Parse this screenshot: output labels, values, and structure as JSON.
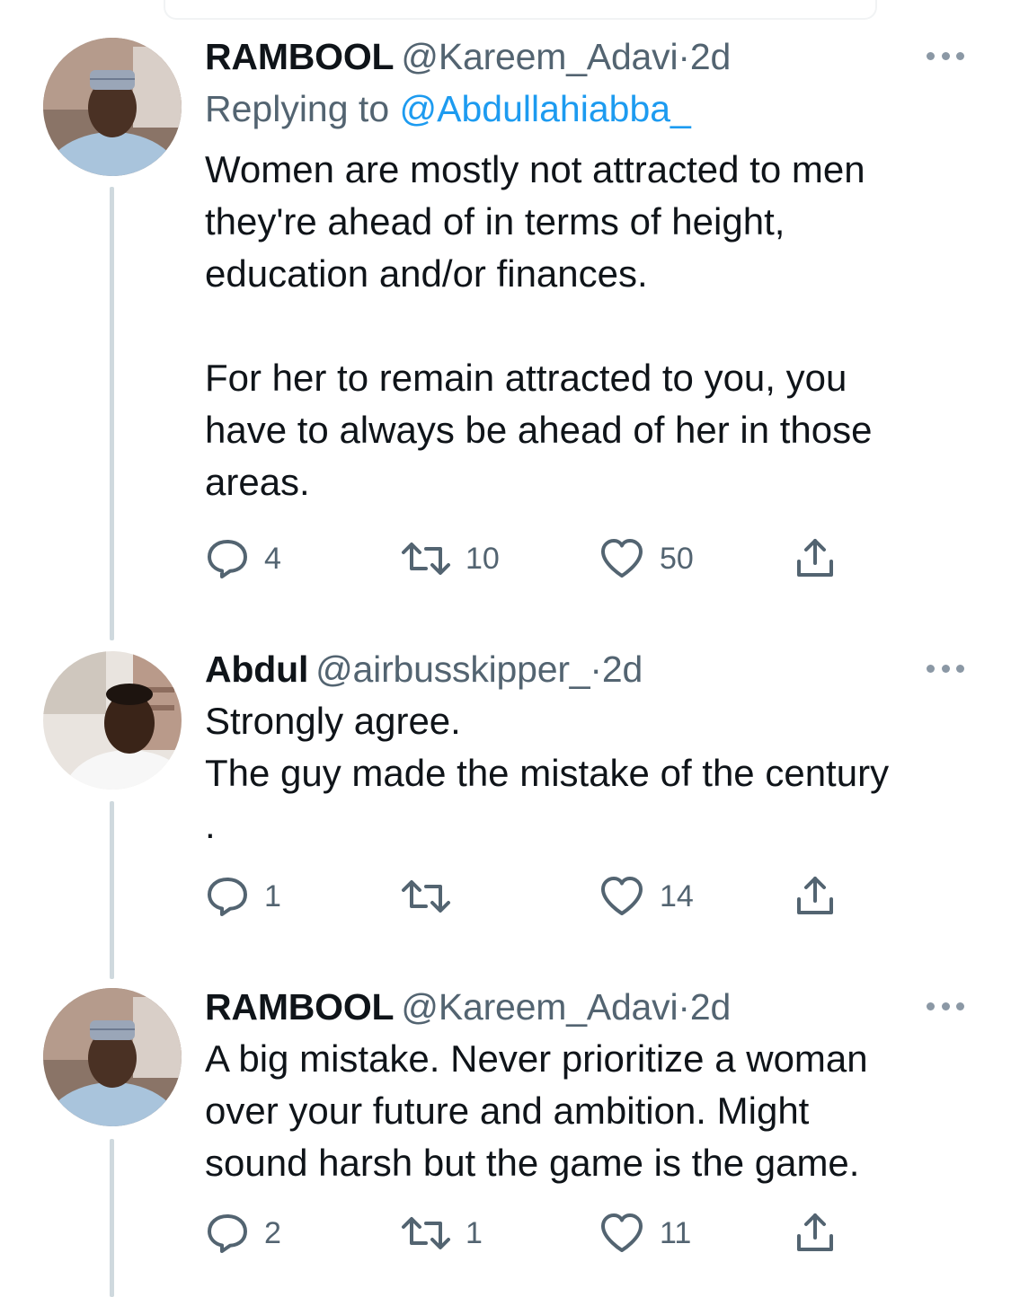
{
  "tweets": [
    {
      "display_name": "RAMBOOL",
      "handle": "@Kareem_Adavi",
      "separator": "·",
      "time": "2d",
      "replying_prefix": "Replying to",
      "replying_handle": "@Abdullahiabba_",
      "text": "Women are mostly not attracted to men\nthey're ahead of in terms of height,\neducation and/or finances.\n\nFor her to remain attracted to you, you\nhave to always be ahead of her in those\nareas.",
      "counts": {
        "replies": "4",
        "retweets": "10",
        "likes": "50"
      }
    },
    {
      "display_name": "Abdul",
      "handle": "@airbusskipper_",
      "separator": "·",
      "time": "2d",
      "text": "Strongly agree.\nThe guy made the mistake of the century\n.",
      "counts": {
        "replies": "1",
        "retweets": "",
        "likes": "14"
      }
    },
    {
      "display_name": "RAMBOOL",
      "handle": "@Kareem_Adavi",
      "separator": "·",
      "time": "2d",
      "text": "A big mistake. Never prioritize a woman\nover your future and ambition. Might\nsound harsh but the game is the game.",
      "counts": {
        "replies": "2",
        "retweets": "1",
        "likes": "11"
      }
    }
  ],
  "icons": {
    "reply": "reply-icon",
    "retweet": "retweet-icon",
    "like": "heart-icon",
    "share": "share-icon",
    "more": "more-icon"
  },
  "colors": {
    "text": "#0f1419",
    "secondary": "#536471",
    "link": "#1d9bf0",
    "thread_line": "#cfd9de"
  }
}
